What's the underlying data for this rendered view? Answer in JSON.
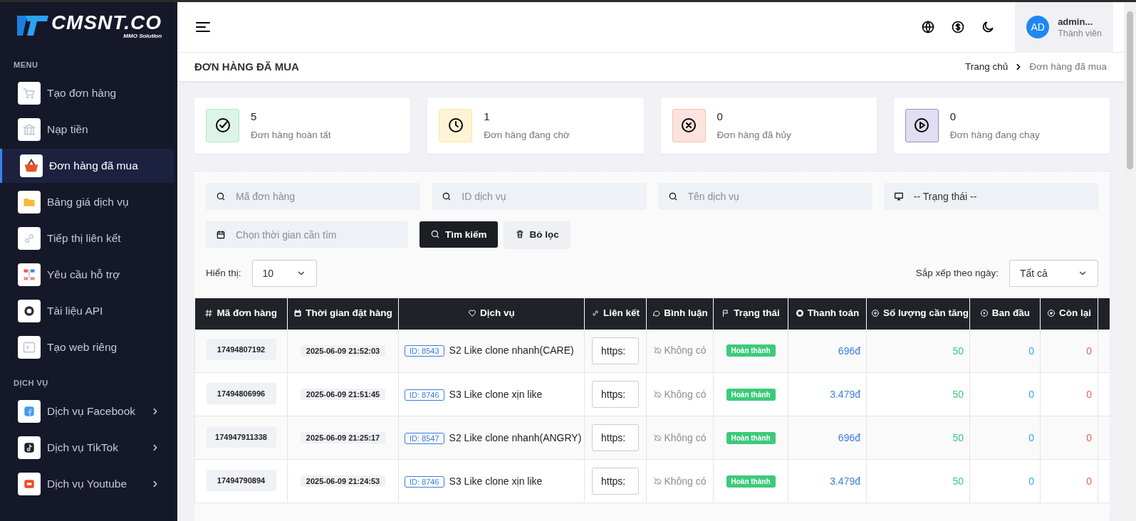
{
  "logo": {
    "title": "CMSNT.CO",
    "tagline": "MMO Solution"
  },
  "sidebar": {
    "sections": [
      {
        "title": "MENU",
        "items": [
          {
            "label": "Tạo đơn hàng",
            "selected": false,
            "expandable": false
          },
          {
            "label": "Nạp tiền",
            "selected": false,
            "expandable": false
          },
          {
            "label": "Đơn hàng đã mua",
            "selected": true,
            "expandable": false
          },
          {
            "label": "Bảng giá dịch vụ",
            "selected": false,
            "expandable": false
          },
          {
            "label": "Tiếp thị liên kết",
            "selected": false,
            "expandable": false
          },
          {
            "label": "Yêu cầu hỗ trợ",
            "selected": false,
            "expandable": false
          },
          {
            "label": "Tài liệu API",
            "selected": false,
            "expandable": false
          },
          {
            "label": "Tạo web riêng",
            "selected": false,
            "expandable": false
          }
        ]
      },
      {
        "title": "DỊCH VỤ",
        "items": [
          {
            "label": "Dịch vụ Facebook",
            "selected": false,
            "expandable": true
          },
          {
            "label": "Dịch vụ TikTok",
            "selected": false,
            "expandable": true
          },
          {
            "label": "Dịch vụ Youtube",
            "selected": false,
            "expandable": true
          }
        ]
      }
    ]
  },
  "header": {
    "user": {
      "initials": "AD",
      "name": "admin...",
      "role": "Thành viên"
    }
  },
  "page": {
    "title": "ĐƠN HÀNG ĐÃ MUA",
    "breadcrumb": [
      "Trang chủ",
      "Đơn hàng đã mua"
    ]
  },
  "stats": [
    {
      "kind": "done",
      "value": "5",
      "label": "Đơn hàng hoàn tất"
    },
    {
      "kind": "pending",
      "value": "1",
      "label": "Đơn hàng đang chờ"
    },
    {
      "kind": "cancelled",
      "value": "0",
      "label": "Đơn hàng đã hủy"
    },
    {
      "kind": "running",
      "value": "0",
      "label": "Đơn hàng đang chạy"
    }
  ],
  "filters": {
    "order_id": {
      "placeholder": "Mã đơn hàng"
    },
    "service_id": {
      "placeholder": "ID dịch vụ"
    },
    "service_name": {
      "placeholder": "Tên dịch vụ"
    },
    "status": {
      "value": "-- Trạng thái --"
    },
    "date": {
      "placeholder": "Chọn thời gian cần tìm"
    },
    "buttons": [
      {
        "kind": "primary",
        "label": "Tìm kiếm"
      },
      {
        "kind": "secondary",
        "label": "Bỏ lọc"
      }
    ],
    "show": {
      "label": "Hiển thị:",
      "value": "10"
    },
    "sort": {
      "label": "Sắp xếp theo ngày:",
      "value": "Tất cả"
    }
  },
  "table": {
    "columns": [
      "Mã đơn hàng",
      "Thời gian đặt hàng",
      "Dịch vụ",
      "Liên kết",
      "Bình luận",
      "Trạng thái",
      "Thanh toán",
      "Số lượng cần tăng",
      "Ban đầu",
      "Còn lại"
    ],
    "rows": [
      {
        "order_id": "17494807192",
        "time": "2025-06-09 21:52:03",
        "service_id": "ID: 8543",
        "service": "S2 Like clone nhanh(CARE)",
        "link": "https:",
        "comment": "Không có",
        "status": "Hoàn thành",
        "payment": "696đ",
        "quantity": "50",
        "start": "0",
        "remaining": "0"
      },
      {
        "order_id": "17494806996",
        "time": "2025-06-09 21:51:45",
        "service_id": "ID: 8746",
        "service": "S3 Like clone xịn like",
        "link": "https:",
        "comment": "Không có",
        "status": "Hoàn thành",
        "payment": "3.479đ",
        "quantity": "50",
        "start": "0",
        "remaining": "0"
      },
      {
        "order_id": "174947911338",
        "time": "2025-06-09 21:25:17",
        "service_id": "ID: 8547",
        "service": "S2 Like clone nhanh(ANGRY)",
        "link": "https:",
        "comment": "Không có",
        "status": "Hoàn thành",
        "payment": "696đ",
        "quantity": "50",
        "start": "0",
        "remaining": "0"
      },
      {
        "order_id": "17494790894",
        "time": "2025-06-09 21:24:53",
        "service_id": "ID: 8746",
        "service": "S3 Like clone xịn like",
        "link": "https:",
        "comment": "Không có",
        "status": "Hoàn thành",
        "payment": "3.479đ",
        "quantity": "50",
        "start": "0",
        "remaining": "0"
      }
    ]
  }
}
